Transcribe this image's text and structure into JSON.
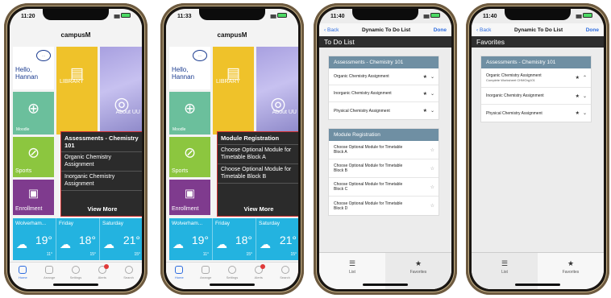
{
  "phones": {
    "p1": {
      "time": "11:20",
      "app_title": "campusM",
      "hello_text": "Hello, Hannan",
      "tiles": {
        "library": "LIBRARY",
        "moodle": "Moodle",
        "about": "About UU",
        "sports": "Sports",
        "enrollment": "Enrollment"
      },
      "popup": {
        "header": "Assessments - Chemistry 101",
        "rows": [
          "Organic Chemistry Assignment",
          "Inorganic Chemistry Assignment"
        ],
        "more": "View More"
      },
      "weather": [
        {
          "day": "Wolverham...",
          "temp": "19°",
          "small": "11°"
        },
        {
          "day": "Friday",
          "temp": "18°",
          "small": "15°"
        },
        {
          "day": "Saturday",
          "temp": "21°",
          "small": "15°"
        }
      ],
      "tabs": [
        "Home",
        "Arrange",
        "Settings",
        "Alerts",
        "Search"
      ]
    },
    "p2": {
      "time": "11:33",
      "app_title": "campusM",
      "hello_text": "Hello, Hannan",
      "tiles": {
        "library": "LIBRARY",
        "moodle": "Moodle",
        "about": "About UU",
        "sports": "Sports",
        "enrollment": "Enrollment"
      },
      "popup": {
        "header": "Module Registration",
        "rows": [
          "Choose Optional Module for Timetable Block A",
          "Choose Optional Module for Timetable Block B"
        ],
        "more": "View More"
      },
      "weather": [
        {
          "day": "Wolverham...",
          "temp": "19°",
          "small": "11°"
        },
        {
          "day": "Friday",
          "temp": "18°",
          "small": "15°"
        },
        {
          "day": "Saturday",
          "temp": "21°",
          "small": "15°"
        }
      ],
      "tabs": [
        "Home",
        "Arrange",
        "Settings",
        "Alerts",
        "Search"
      ]
    },
    "p3": {
      "time": "11:40",
      "nav_back": "Back",
      "nav_title": "Dynamic To Do List",
      "nav_done": "Done",
      "header": "To Do List",
      "card1": {
        "title": "Assessments - Chemistry 101",
        "rows": [
          "Organic Chemistry Assignment",
          "Inorganic Chemistry Assignment",
          "Physical Chemistry Assignment"
        ]
      },
      "card2": {
        "title": "Module Registration",
        "rows": [
          "Choose Optional Module for Timetable Block A",
          "Choose Optional Module for Timetable Block B",
          "Choose Optional Module for Timetable Block C",
          "Choose Optional Module for Timetable Block D"
        ]
      },
      "tab_list": "List",
      "tab_fav": "Favorites"
    },
    "p4": {
      "time": "11:40",
      "nav_back": "Back",
      "nav_title": "Dynamic To Do List",
      "nav_done": "Done",
      "header": "Favorites",
      "card1": {
        "title": "Assessments - Chemistry 101",
        "rows": [
          {
            "label": "Organic Chemistry Assignment",
            "sub": "Complete Worksheet CHMOrg101"
          },
          {
            "label": "Inorganic Chemistry Assignment",
            "sub": ""
          },
          {
            "label": "Physical Chemistry Assignment",
            "sub": ""
          }
        ]
      },
      "tab_list": "List",
      "tab_fav": "Favorites"
    }
  },
  "colors": {
    "accent": "#2d6cdf",
    "popup_border": "#d23030",
    "card_header": "#6f8fa3"
  }
}
